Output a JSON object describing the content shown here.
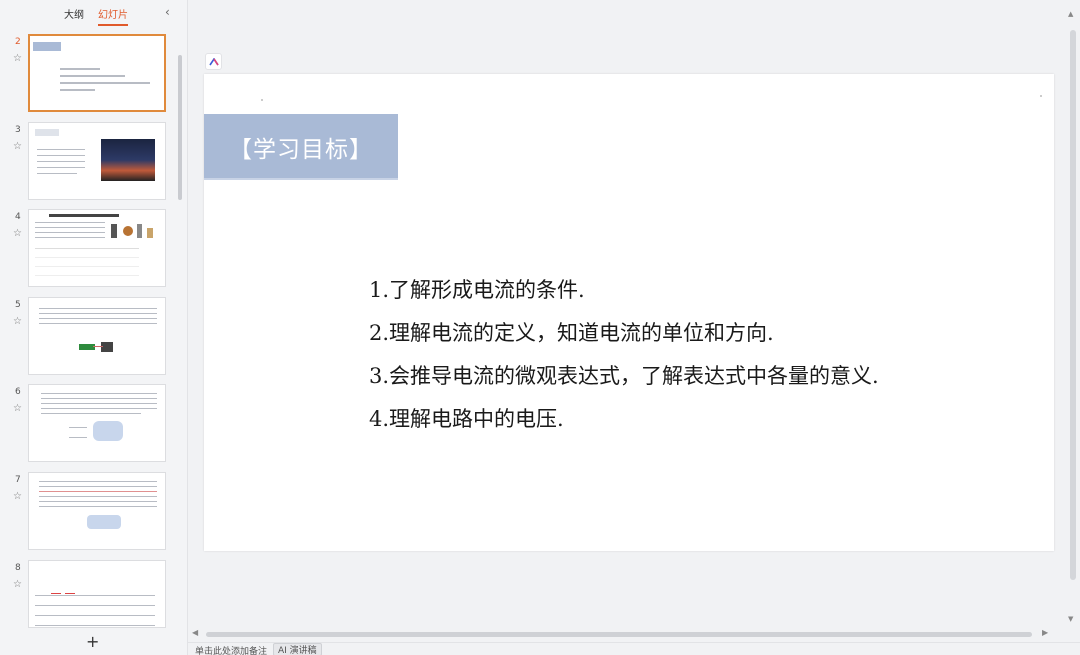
{
  "panel": {
    "tabs": [
      {
        "label": "大纲",
        "active": false
      },
      {
        "label": "幻灯片",
        "active": true
      }
    ],
    "collapse_icon": "chevron-left-icon",
    "add_label": "+"
  },
  "slides": [
    {
      "number": "2",
      "current": true
    },
    {
      "number": "3",
      "current": false
    },
    {
      "number": "4",
      "current": false
    },
    {
      "number": "5",
      "current": false
    },
    {
      "number": "6",
      "current": false
    },
    {
      "number": "7",
      "current": false
    },
    {
      "number": "8",
      "current": false
    }
  ],
  "slide": {
    "title": "【学习目标】",
    "objectives": [
      "1.了解形成电流的条件.",
      "2.理解电流的定义，知道电流的单位和方向.",
      "3.会推导电流的微观表达式，了解表达式中各量的意义.",
      "4.理解电路中的电压."
    ],
    "title_color": "#a9bad6"
  },
  "status": {
    "notes_hint": "单击此处添加备注",
    "ai_label": "AI 演讲稿"
  },
  "colors": {
    "accent": "#e05a2b",
    "current_border": "#e08a3c"
  }
}
